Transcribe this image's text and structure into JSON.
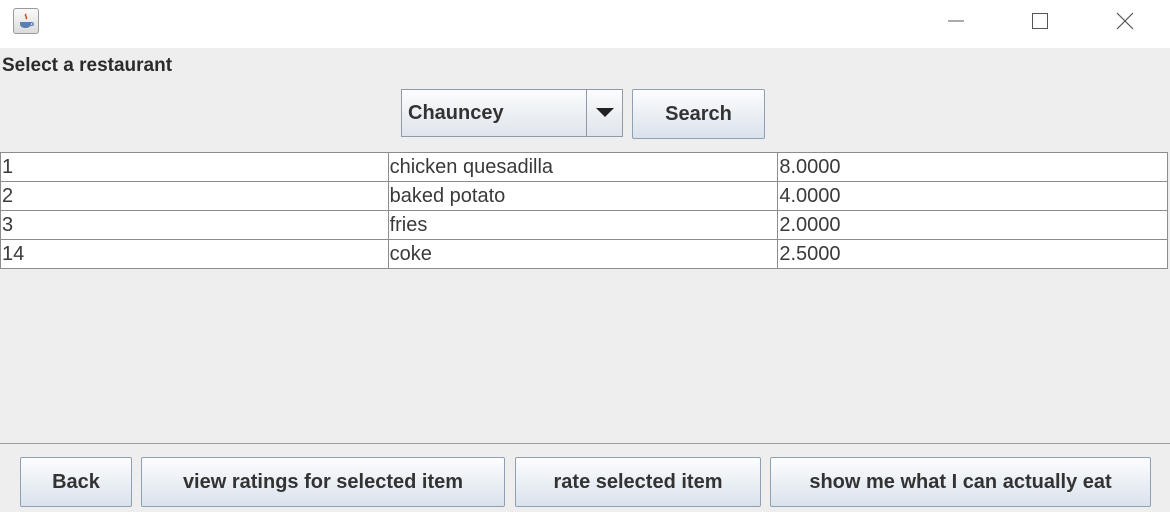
{
  "window": {
    "icons": {
      "app": "java-icon",
      "minimize": "minimize-icon",
      "maximize": "maximize-icon",
      "close": "close-icon"
    }
  },
  "header": {
    "label": "Select a restaurant"
  },
  "restaurant_select": {
    "selected": "Chauncey"
  },
  "search_button": {
    "label": "Search"
  },
  "menu_table": {
    "rows": [
      {
        "id": "1",
        "name": "chicken quesadilla",
        "price": "8.0000"
      },
      {
        "id": "2",
        "name": "baked potato",
        "price": "4.0000"
      },
      {
        "id": "3",
        "name": "fries",
        "price": "2.0000"
      },
      {
        "id": "14",
        "name": "coke",
        "price": "2.5000"
      }
    ]
  },
  "actions": {
    "back": "Back",
    "view_ratings": "view ratings for selected item",
    "rate": "rate selected item",
    "show_eat": "show me what I can actually eat"
  }
}
